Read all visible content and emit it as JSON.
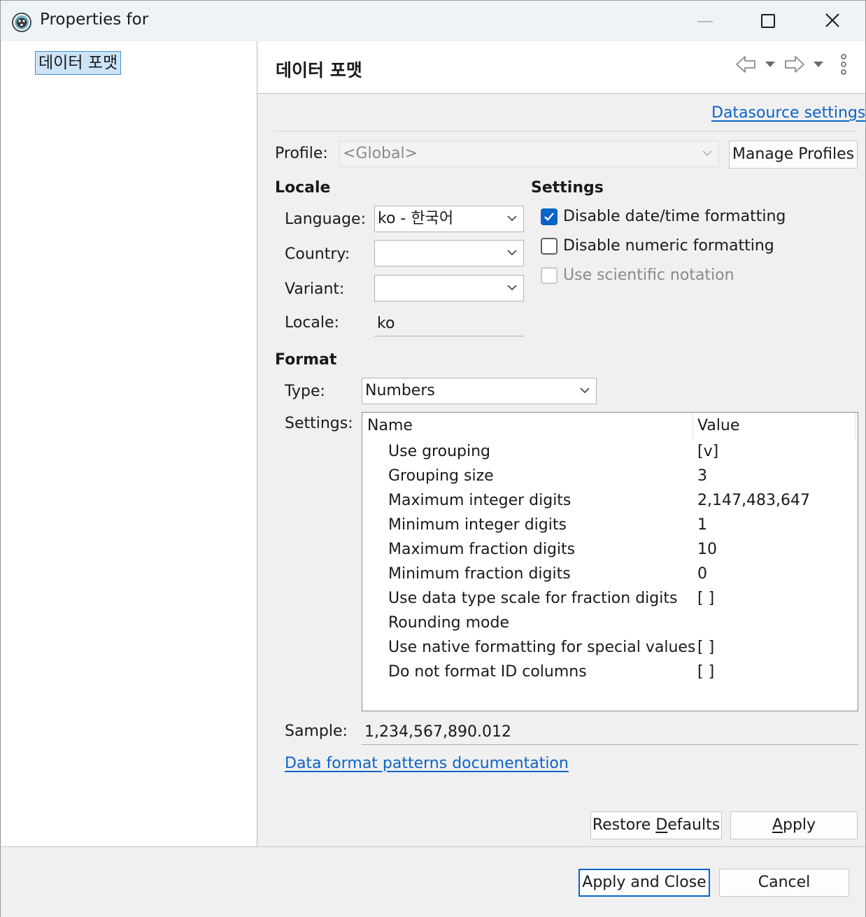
{
  "window": {
    "title": "Properties for",
    "icon": "dbeaver-beaver-icon"
  },
  "tree": {
    "items": [
      {
        "label": "데이터 포맷",
        "selected": true
      }
    ]
  },
  "page": {
    "title": "데이터 포맷",
    "nav_icons": [
      "back-arrow-icon",
      "dropdown-icon",
      "forward-arrow-icon",
      "dropdown-icon",
      "more-vertical-icon"
    ],
    "datasource_link": "Datasource settings",
    "profile_label": "Profile:",
    "profile_value": "<Global>",
    "manage_profiles": "Manage Profiles"
  },
  "locale": {
    "heading": "Locale",
    "language_label": "Language:",
    "language_value": "ko - 한국어",
    "country_label": "Country:",
    "country_value": "",
    "variant_label": "Variant:",
    "variant_value": "",
    "locale_label": "Locale:",
    "locale_value": "ko"
  },
  "settings": {
    "heading": "Settings",
    "options": [
      {
        "label": "Disable date/time formatting",
        "checked": true,
        "enabled": true
      },
      {
        "label": "Disable numeric formatting",
        "checked": false,
        "enabled": true
      },
      {
        "label": "Use scientific notation",
        "checked": false,
        "enabled": false
      }
    ]
  },
  "format": {
    "heading": "Format",
    "type_label": "Type:",
    "type_value": "Numbers",
    "settings_label": "Settings:",
    "columns": [
      "Name",
      "Value"
    ],
    "rows": [
      {
        "name": "Use grouping",
        "value": "[v]"
      },
      {
        "name": "Grouping size",
        "value": "3"
      },
      {
        "name": "Maximum integer digits",
        "value": "2,147,483,647"
      },
      {
        "name": "Minimum integer digits",
        "value": "1"
      },
      {
        "name": "Maximum fraction digits",
        "value": "10"
      },
      {
        "name": "Minimum fraction digits",
        "value": "0"
      },
      {
        "name": "Use data type scale for fraction digits",
        "value": "[ ]"
      },
      {
        "name": "Rounding mode",
        "value": ""
      },
      {
        "name": "Use native formatting for special values",
        "value": "[ ]"
      },
      {
        "name": "Do not format ID columns",
        "value": "[ ]"
      }
    ],
    "sample_label": "Sample:",
    "sample_value": "1,234,567,890.012",
    "doc_link": "Data format patterns documentation"
  },
  "buttons": {
    "restore_pre": "Restore ",
    "restore_mn": "D",
    "restore_post": "efaults",
    "apply_mn": "A",
    "apply_post": "pply",
    "apply_close": "Apply and Close",
    "cancel": "Cancel"
  },
  "colors": {
    "accent": "#0a64c8",
    "selection_bg": "#cde4f7"
  }
}
